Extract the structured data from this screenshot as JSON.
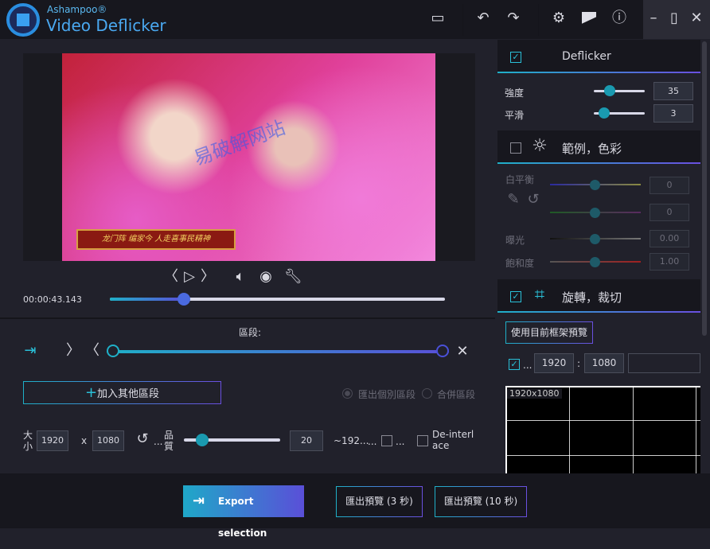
{
  "app": {
    "brand": "Ashampoo®",
    "title": "Video Deflicker"
  },
  "toolbar": {
    "icons": [
      "folder-icon",
      "undo-icon",
      "redo-icon",
      "gear-icon",
      "theme-icon",
      "info-icon",
      "minimize-icon",
      "maximize-icon",
      "close-icon"
    ]
  },
  "player": {
    "caption": "龙门阵 编家今 人走喜事民精神",
    "watermark": "易破解网站",
    "timecode": "00:00:43.143",
    "progress_percent": 22
  },
  "segment": {
    "label": "區段:",
    "add_label": "加入其他區段",
    "export_each": "匯出個別區段",
    "merge": "合併區段",
    "range": [
      0,
      100
    ]
  },
  "output": {
    "size_label": "大小",
    "width": "1920",
    "x": "x",
    "height": "1080",
    "more1": "...",
    "quality_label": "品質",
    "quality": "20",
    "quality_percent": 19,
    "estimate": "~192...",
    "more2": "...",
    "more3": "...",
    "deinterlace": "De-interlace"
  },
  "deflicker": {
    "title": "Deflicker",
    "enabled": true,
    "intensity_label": "強度",
    "intensity": "35",
    "intensity_percent": 33,
    "smooth_label": "平滑",
    "smooth": "3",
    "smooth_percent": 22
  },
  "color": {
    "title": "範例，色彩",
    "enabled": false,
    "wb_label": "白平衡",
    "wb1": "0",
    "wb2": "0",
    "exposure_label": "曝光",
    "exposure": "0.00",
    "saturation_label": "飽和度",
    "saturation": "1.00"
  },
  "crop": {
    "title": "旋轉，裁切",
    "enabled": true,
    "use_frame": "使用目前框架預覽",
    "keep_ratio": true,
    "more": "...",
    "w": "1920",
    "colon": ":",
    "h": "1080",
    "preview_label": "1920x1080"
  },
  "footer": {
    "export": "Export selection",
    "preview3": "匯出預覽 (3 秒)",
    "preview10": "匯出預覽 (10 秒)"
  },
  "colors": {
    "accent_teal": "#1fb0c8",
    "accent_purple": "#5a4fd8"
  }
}
